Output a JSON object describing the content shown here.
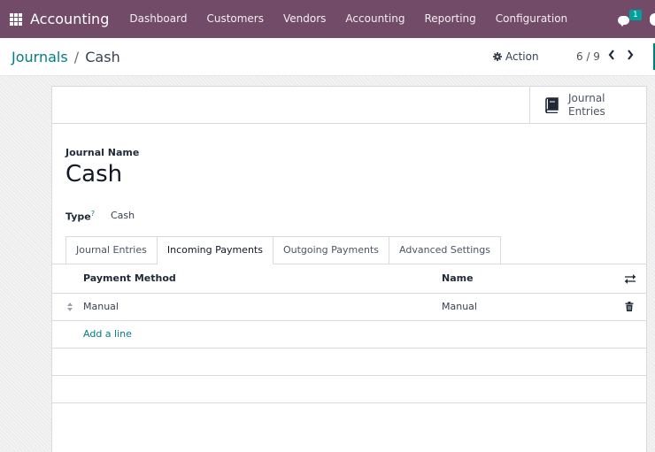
{
  "navbar": {
    "app_name": "Accounting",
    "menu": [
      "Dashboard",
      "Customers",
      "Vendors",
      "Accounting",
      "Reporting",
      "Configuration"
    ],
    "chat_badge": "1",
    "bg_color": "#714b67"
  },
  "control_panel": {
    "breadcrumb_parent": "Journals",
    "breadcrumb_separator": "/",
    "breadcrumb_current": "Cash",
    "action_label": "Action",
    "pager": "6 / 9"
  },
  "form": {
    "stat_button": {
      "line1": "Journal",
      "line2": "Entries",
      "icon": "book-icon"
    },
    "journal_name_label": "Journal Name",
    "journal_name": "Cash",
    "type_label": "Type",
    "type_help": "?",
    "type_value": "Cash",
    "tabs": [
      {
        "label": "Journal Entries",
        "active": false
      },
      {
        "label": "Incoming Payments",
        "active": true
      },
      {
        "label": "Outgoing Payments",
        "active": false
      },
      {
        "label": "Advanced Settings",
        "active": false
      }
    ],
    "list": {
      "columns": [
        "Payment Method",
        "Name"
      ],
      "rows": [
        {
          "payment_method": "Manual",
          "name": "Manual"
        }
      ],
      "add_line": "Add a line"
    }
  },
  "colors": {
    "link": "#017e84",
    "accent": "#714b67"
  }
}
